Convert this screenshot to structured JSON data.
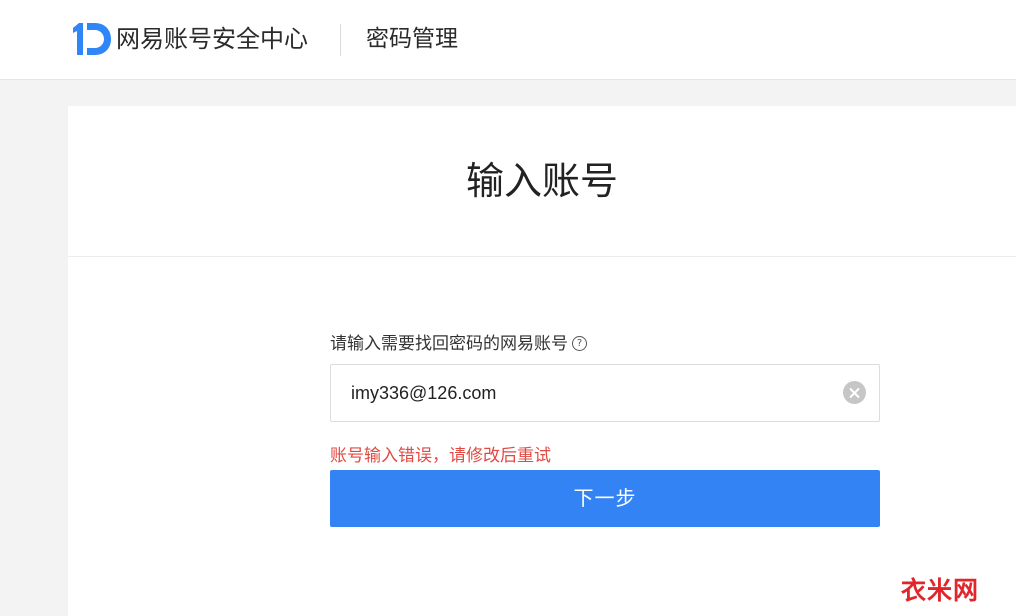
{
  "header": {
    "brand": "网易账号安全中心",
    "section": "密码管理"
  },
  "card": {
    "title": "输入账号",
    "field_label": "请输入需要找回密码的网易账号",
    "input_value": "imy336@126.com",
    "error": "账号输入错误，请修改后重试",
    "next_button": "下一步"
  },
  "icons": {
    "logo": "netease-id-logo-icon",
    "help": "help-circle-icon",
    "clear": "clear-input-icon"
  },
  "colors": {
    "logo_blue": "#2f86f6",
    "button_blue": "#3483f5",
    "error_red": "#e04a43",
    "watermark_red": "#e0262b"
  },
  "watermark": "衣米网"
}
